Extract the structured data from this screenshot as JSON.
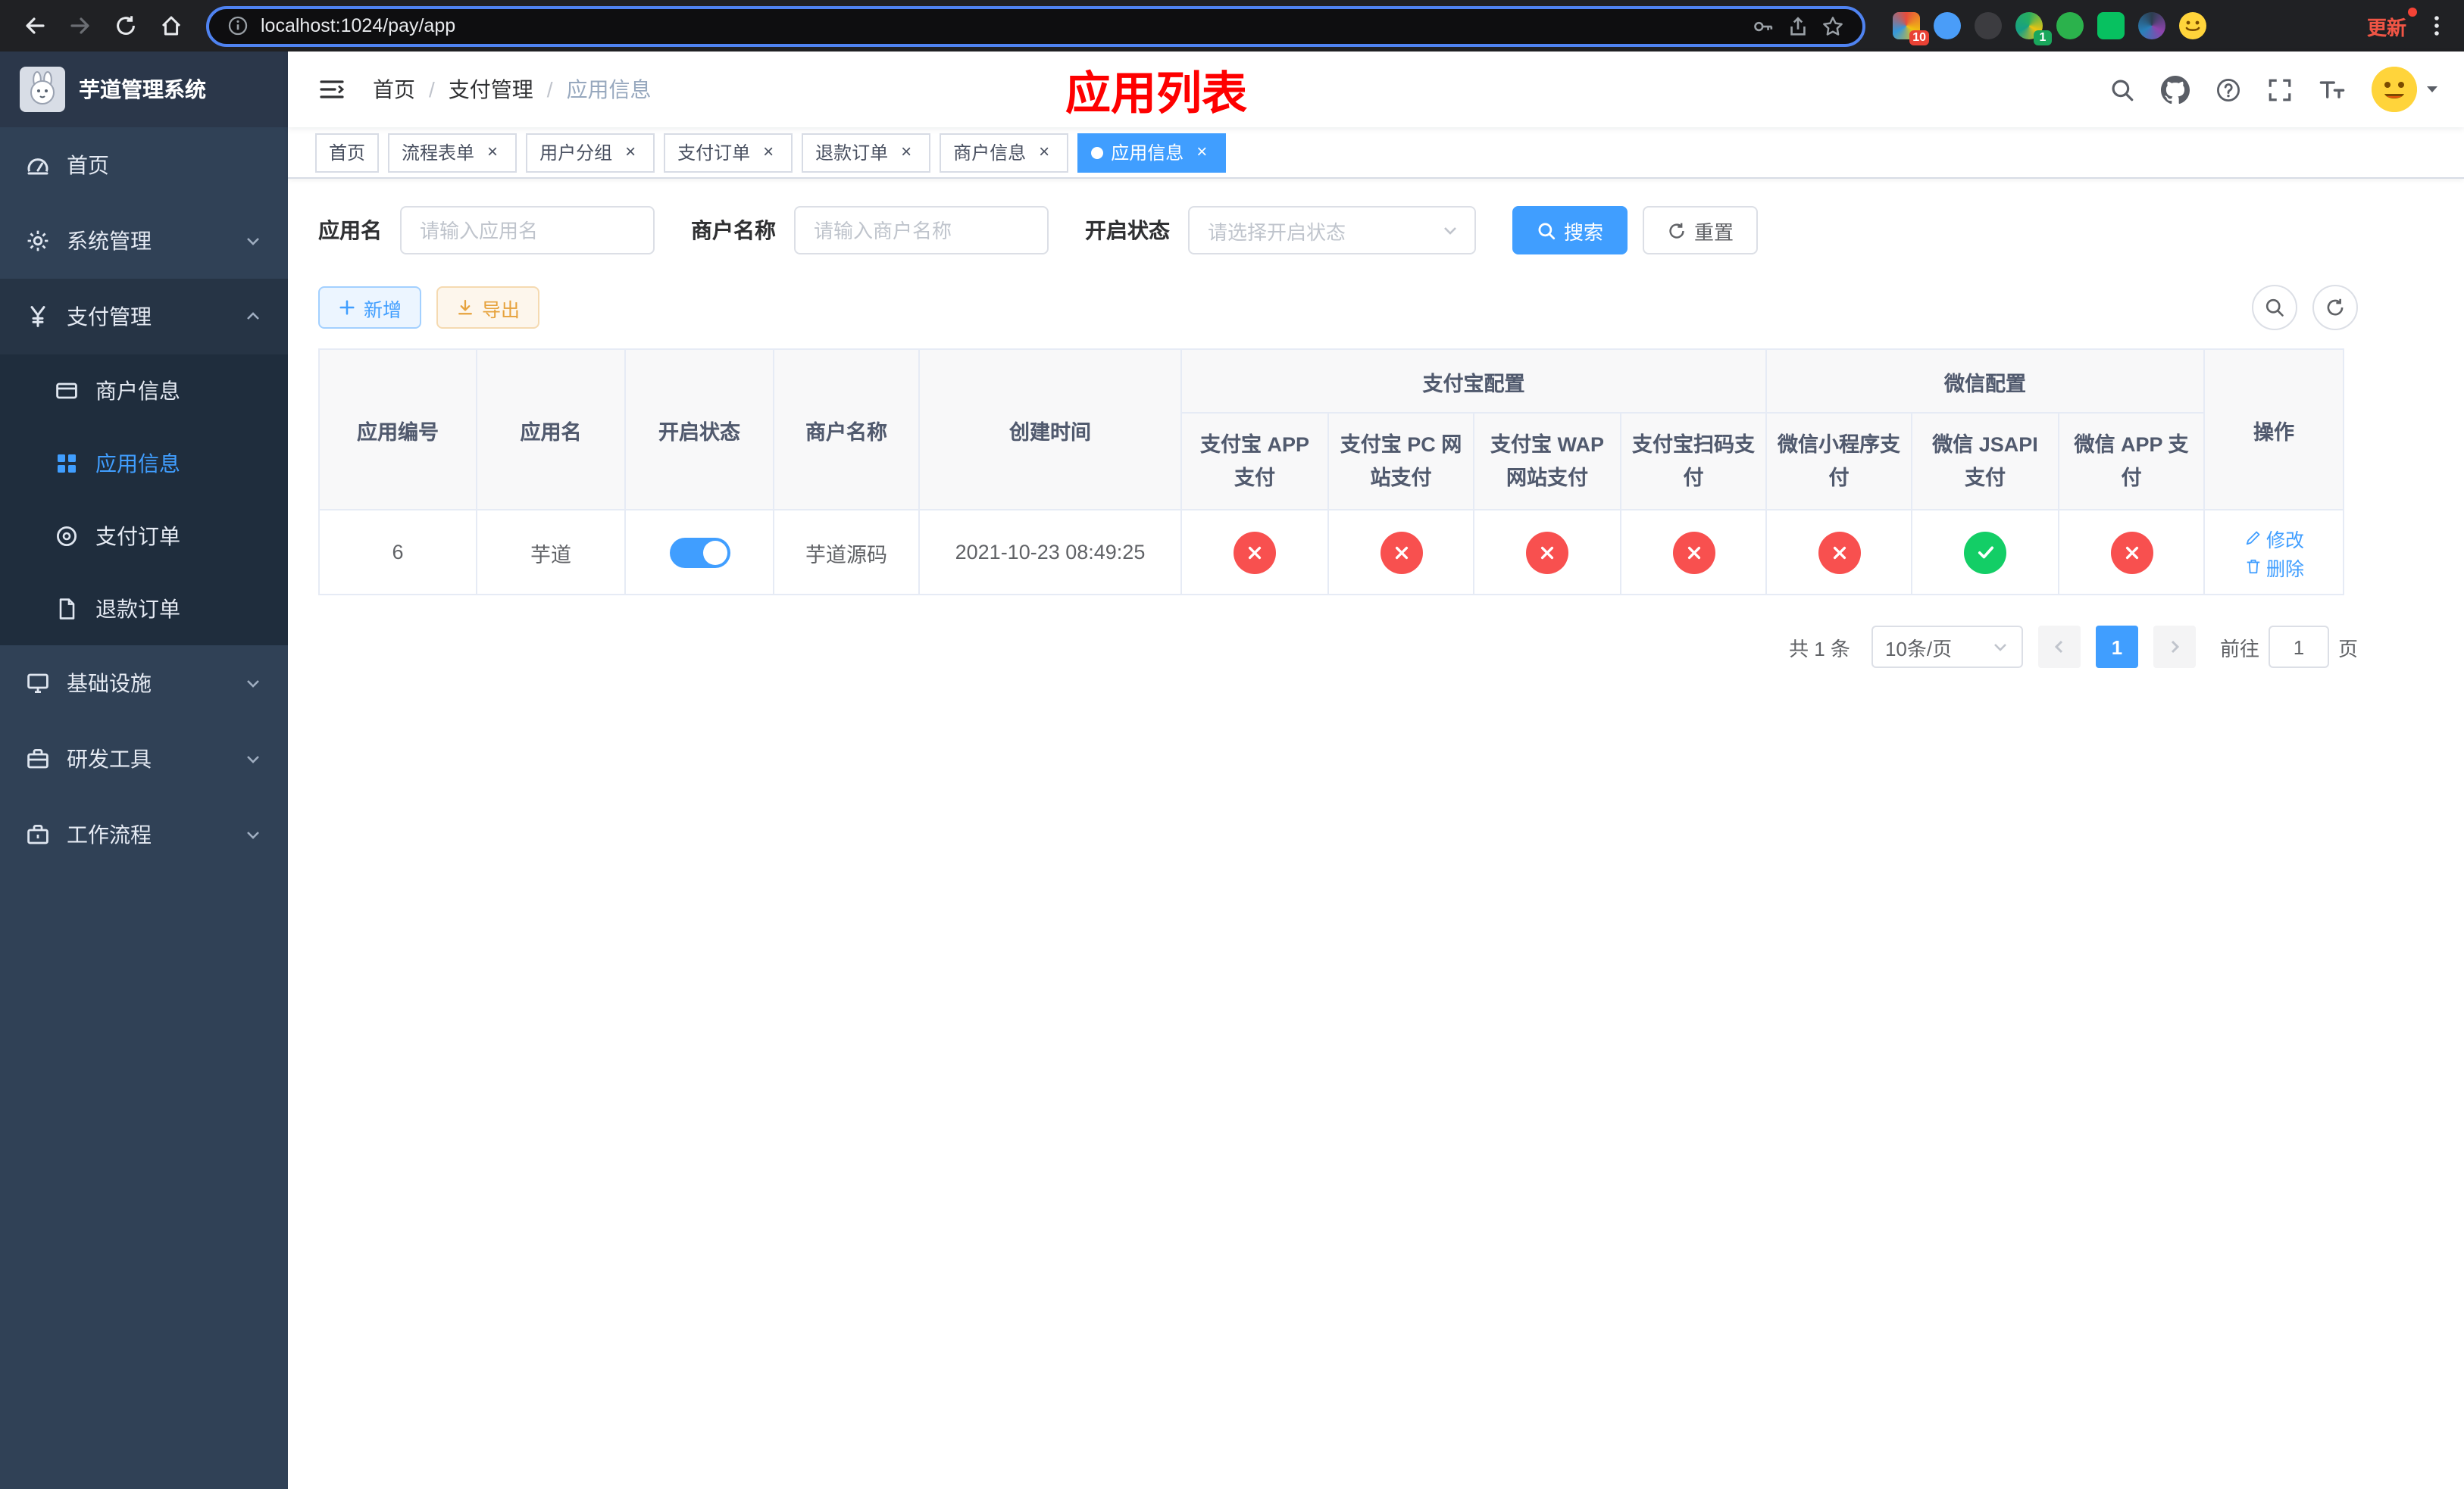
{
  "browser": {
    "url": "localhost:1024/pay/app",
    "update_label": "更新",
    "ext_badge_1": "10",
    "ext_badge_2": "1"
  },
  "ui": {
    "close_glyph": "×",
    "breadcrumb_separator": "/"
  },
  "sidebar": {
    "title": "芋道管理系统",
    "items": [
      {
        "label": "首页"
      },
      {
        "label": "系统管理"
      },
      {
        "label": "支付管理"
      },
      {
        "label": "基础设施"
      },
      {
        "label": "研发工具"
      },
      {
        "label": "工作流程"
      }
    ],
    "submenu": [
      {
        "label": "商户信息"
      },
      {
        "label": "应用信息"
      },
      {
        "label": "支付订单"
      },
      {
        "label": "退款订单"
      }
    ]
  },
  "header": {
    "breadcrumb": [
      "首页",
      "支付管理",
      "应用信息"
    ],
    "page_title": "应用列表"
  },
  "tabs": [
    {
      "label": "首页"
    },
    {
      "label": "流程表单"
    },
    {
      "label": "用户分组"
    },
    {
      "label": "支付订单"
    },
    {
      "label": "退款订单"
    },
    {
      "label": "商户信息"
    },
    {
      "label": "应用信息"
    }
  ],
  "filters": {
    "app_name_label": "应用名",
    "app_name_placeholder": "请输入应用名",
    "merchant_name_label": "商户名称",
    "merchant_name_placeholder": "请输入商户名称",
    "status_label": "开启状态",
    "status_placeholder": "请选择开启状态",
    "search_label": "搜索",
    "reset_label": "重置"
  },
  "toolbar": {
    "add_label": "新增",
    "export_label": "导出"
  },
  "table": {
    "headers": {
      "app_id": "应用编号",
      "app_name": "应用名",
      "status": "开启状态",
      "merchant_name": "商户名称",
      "create_time": "创建时间",
      "alipay_group": "支付宝配置",
      "wechat_group": "微信配置",
      "alipay_app": "支付宝 APP 支付",
      "alipay_pc": "支付宝 PC 网站支付",
      "alipay_wap": "支付宝 WAP 网站支付",
      "alipay_qr": "支付宝扫码支付",
      "wechat_mini": "微信小程序支付",
      "wechat_jsapi": "微信 JSAPI 支付",
      "wechat_app": "微信 APP 支付",
      "actions": "操作"
    },
    "rows": [
      {
        "app_id": "6",
        "app_name": "芋道",
        "status_on": true,
        "merchant_name": "芋道源码",
        "create_time": "2021-10-23 08:49:25",
        "channels": {
          "alipay_app": false,
          "alipay_pc": false,
          "alipay_wap": false,
          "alipay_qr": false,
          "wechat_mini": false,
          "wechat_jsapi": true,
          "wechat_app": false
        },
        "edit_label": "修改",
        "delete_label": "删除"
      }
    ]
  },
  "pagination": {
    "total": "共 1 条",
    "page_size": "10条/页",
    "page": "1",
    "goto_label": "前往",
    "goto_value": "1",
    "unit_label": "页"
  }
}
